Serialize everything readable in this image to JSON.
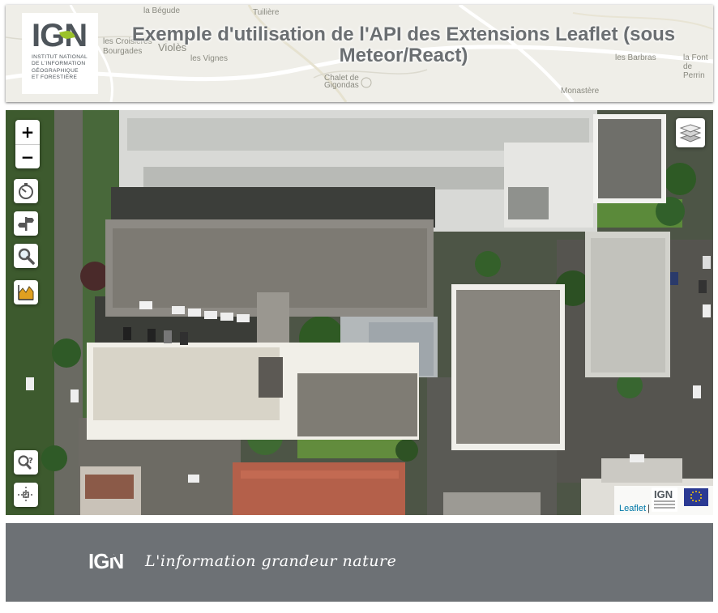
{
  "header": {
    "title": "Exemple d'utilisation de l'API des Extensions Leaflet (sous Meteor/React)",
    "logo": {
      "text": "IGN",
      "subtitle": "INSTITUT NATIONAL\nDE L'INFORMATION\nGÉOGRAPHIQUE\nET FORESTIÈRE"
    },
    "background_labels": [
      "la Bégude",
      "Tuilière",
      "les Croisières",
      "Violès",
      "Bourgades",
      "les Vignes",
      "Chalet de Gigondas",
      "les Barbras",
      "la Font de Perrin",
      "Monastère"
    ]
  },
  "map": {
    "zoom_in_label": "+",
    "zoom_out_label": "−",
    "left_controls": [
      {
        "name": "isochrone-icon"
      },
      {
        "name": "route-icon"
      },
      {
        "name": "search-icon"
      },
      {
        "name": "elevation-profile-icon"
      }
    ],
    "bottom_controls": [
      {
        "name": "reverse-geocode-icon"
      },
      {
        "name": "coordinates-icon"
      }
    ],
    "layer_switcher_icon": "layers-icon",
    "attribution": {
      "link": "Leaflet",
      "separator": "|",
      "ign_logo": "IGN"
    }
  },
  "footer": {
    "logo": "IGN",
    "tagline": "L'information grandeur nature"
  },
  "colors": {
    "header_bg": "#efeee8",
    "title": "#6b6f72",
    "footer_bg": "#6d7175",
    "ign_green": "#9bc22a",
    "eu_blue": "#2b3a93",
    "leaflet_link": "#0078a8"
  }
}
